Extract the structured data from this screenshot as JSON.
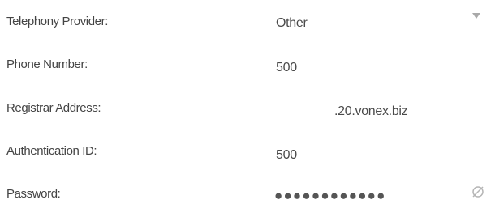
{
  "form": {
    "provider": {
      "label": "Telephony Provider:",
      "value": "Other"
    },
    "phone": {
      "label": "Phone Number:",
      "value": "500"
    },
    "registrar": {
      "label": "Registrar Address:",
      "value": ".20.vonex.biz"
    },
    "auth_id": {
      "label": "Authentication ID:",
      "value": "500"
    },
    "password": {
      "label": "Password:",
      "value": "●●●●●●●●●●●●"
    }
  },
  "icons": {
    "dropdown": "chevron-down-icon",
    "visibility": "eye-slash-icon"
  },
  "colors": {
    "text": "#444444",
    "arrow": "#a9a9a9",
    "icon": "#b5b5b5"
  }
}
